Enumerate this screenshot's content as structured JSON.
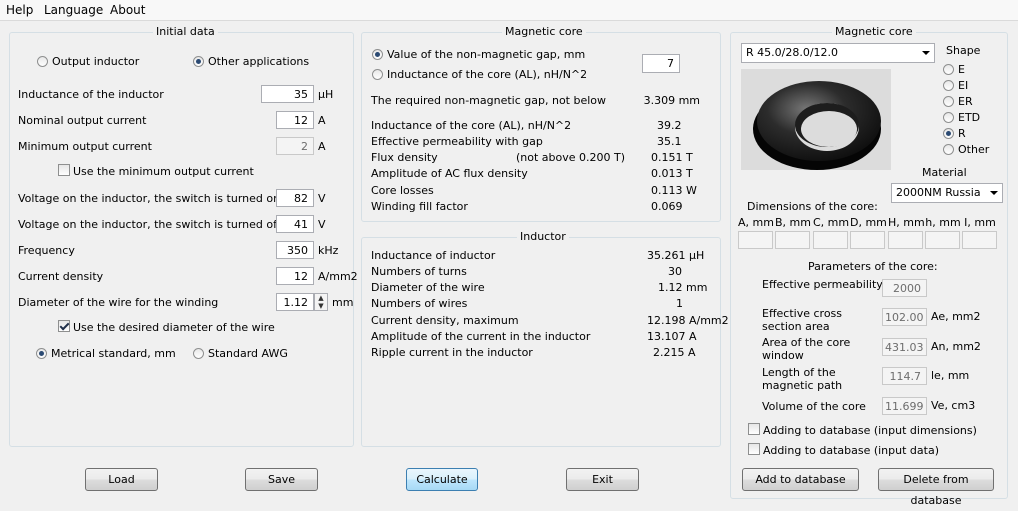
{
  "menu": {
    "help": "Help",
    "language": "Language",
    "about": "About"
  },
  "initial": {
    "title": "Initial data",
    "radio_output_inductor": "Output inductor",
    "radio_other": "Other applications",
    "inductance_label": "Inductance of the inductor",
    "inductance_value": "35",
    "inductance_unit": "µH",
    "nominal_current_label": "Nominal output current",
    "nominal_current_value": "12",
    "nominal_current_unit": "A",
    "min_current_label": "Minimum output current",
    "min_current_value": "2",
    "min_current_unit": "A",
    "use_min_current": "Use the minimum output current",
    "v_on_label": "Voltage on the inductor, the switch is turned on",
    "v_on_value": "82",
    "v_on_unit": "V",
    "v_off_label": "Voltage on the inductor, the switch is turned off",
    "v_off_value": "41",
    "v_off_unit": "V",
    "freq_label": "Frequency",
    "freq_value": "350",
    "freq_unit": "kHz",
    "density_label": "Current density",
    "density_value": "12",
    "density_unit": "A/mm2",
    "diameter_label": "Diameter of the wire for the winding",
    "diameter_value": "1.12",
    "diameter_unit": "mm",
    "use_diameter": "Use the desired diameter of the wire",
    "radio_metric": "Metrical standard, mm",
    "radio_awg": "Standard AWG"
  },
  "core": {
    "title": "Magnetic core",
    "radio_gap": "Value of the non-magnetic gap, mm",
    "radio_al": "Inductance of the core (AL), nH/N^2",
    "gap_value": "7",
    "required_gap_label": "The required non-magnetic gap, not below",
    "required_gap_value": "3.309 mm",
    "rows": [
      {
        "label": "Inductance of the core (AL), nH/N^2",
        "value": "39.2"
      },
      {
        "label": "Effective permeability with gap",
        "value": "35.1"
      },
      {
        "label": "Flux density",
        "note": "(not above 0.200 T)",
        "value": "0.151 T"
      },
      {
        "label": "Amplitude of AC flux density",
        "value": "0.013 T"
      },
      {
        "label": "Core losses",
        "value": "0.113 W"
      },
      {
        "label": "Winding fill factor",
        "value": "0.069"
      }
    ]
  },
  "inductor": {
    "title": "Inductor",
    "rows": [
      {
        "label": "Inductance of inductor",
        "value": "35.261 µH"
      },
      {
        "label": "Numbers of turns",
        "value": "30"
      },
      {
        "label": "Diameter of the wire",
        "value": "1.12 mm"
      },
      {
        "label": "Numbers of wires",
        "value": "1"
      },
      {
        "label": "Current density, maximum",
        "value": "12.198 A/mm2"
      },
      {
        "label": "Amplitude of the current in the inductor",
        "value": "13.107 A"
      },
      {
        "label": "Ripple current in the inductor",
        "value": "2.215 A"
      }
    ]
  },
  "right": {
    "title": "Magnetic core",
    "core_select": "R 45.0/28.0/12.0",
    "shape_title": "Shape",
    "shapes": [
      "E",
      "EI",
      "ER",
      "ETD",
      "R",
      "Other"
    ],
    "material_title": "Material",
    "material_select": "2000NM Russia",
    "dims_title": "Dimensions of the core:",
    "dims": [
      "A, mm",
      "B, mm",
      "C, mm",
      "D, mm",
      "H, mm",
      "h, mm",
      "I, mm"
    ],
    "params_title": "Parameters of the core:",
    "eff_perm_label": "Effective permeability",
    "eff_perm_value": "2000",
    "cross_label_1": "Effective cross",
    "cross_label_2": "section area",
    "cross_value": "102.00",
    "cross_unit": "Ae, mm2",
    "window_label_1": "Area of the core",
    "window_label_2": "window",
    "window_value": "431.03",
    "window_unit": "An, mm2",
    "path_label_1": "Length of the",
    "path_label_2": "magnetic path",
    "path_value": "114.7",
    "path_unit": "le, mm",
    "volume_label": "Volume of the core",
    "volume_value": "11.699",
    "volume_unit": "Ve, cm3",
    "add_dims": "Adding to database (input dimensions)",
    "add_data": "Adding to database (input data)",
    "add_btn": "Add to database",
    "delete_btn": "Delete from database"
  },
  "buttons": {
    "load": "Load",
    "save": "Save",
    "calculate": "Calculate",
    "exit": "Exit"
  }
}
